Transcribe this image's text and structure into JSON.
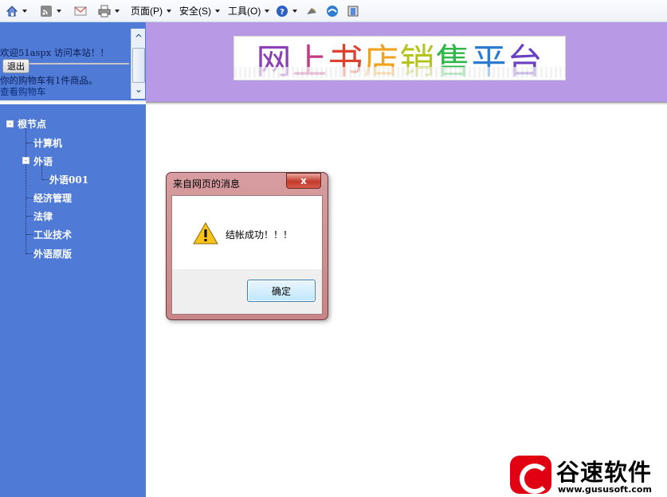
{
  "toolbar": {
    "page_menu": "页面(P)",
    "safety_menu": "安全(S)",
    "tools_menu": "工具(O)"
  },
  "left_top": {
    "welcome": "欢迎51aspx 访问本站！！",
    "logout_label": "退出",
    "cart_info": "你的购物车有1件商品。",
    "view_cart": "查看购物车"
  },
  "banner": {
    "title_chars": [
      {
        "ch": "网",
        "color": "#8b3fb5"
      },
      {
        "ch": "上",
        "color": "#c13b86"
      },
      {
        "ch": "书",
        "color": "#e0402e"
      },
      {
        "ch": "店",
        "color": "#f0a21c"
      },
      {
        "ch": "销",
        "color": "#b5c41d"
      },
      {
        "ch": "售",
        "color": "#2fb84a"
      },
      {
        "ch": "平",
        "color": "#2b7ccf"
      },
      {
        "ch": "台",
        "color": "#6a3fc4"
      }
    ]
  },
  "tree": {
    "root": "根节点",
    "items": {
      "computer": "计算机",
      "foreign": "外语",
      "foreign001": "外语001",
      "economy": "经济管理",
      "law": "法律",
      "industry": "工业技术",
      "original": "外语原版"
    }
  },
  "dialog": {
    "title": "来自网页的消息",
    "close": "x",
    "message": "结帐成功！！！",
    "ok": "确定"
  },
  "watermark": {
    "name": "谷速软件",
    "url": "www.gususoft.com"
  }
}
